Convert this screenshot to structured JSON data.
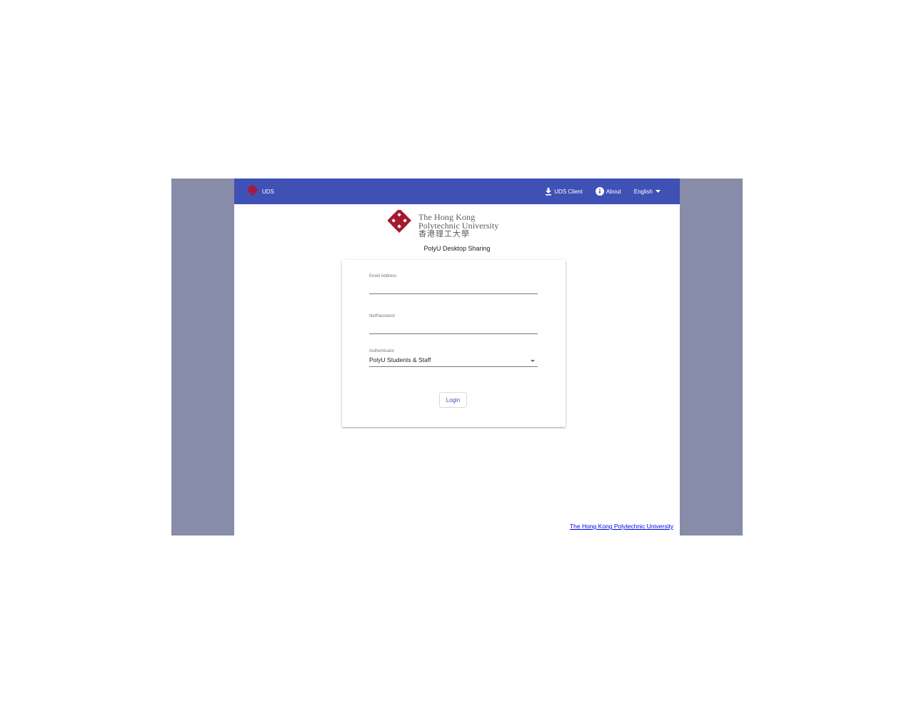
{
  "header": {
    "brand_label": "UDS",
    "client_label": "UDS Client",
    "about_label": "About",
    "language_label": "English",
    "bar_color": "#3f51b5",
    "icons": {
      "brand": "polyu-emblem-icon",
      "client": "download-icon",
      "about": "info-icon",
      "language": "chevron-down-icon"
    }
  },
  "logo": {
    "line1": "The Hong Kong",
    "line2": "Polytechnic University",
    "chinese": "香港理工大學",
    "brand_color": "#a6192e"
  },
  "page": {
    "title": "PolyU Desktop Sharing",
    "background_color": "#878da8"
  },
  "form": {
    "email": {
      "label": "Email Address",
      "value": ""
    },
    "password": {
      "label": "NetPassword",
      "value": ""
    },
    "authenticator": {
      "label": "Authenticator",
      "selected": "PolyU Students & Staff"
    },
    "login_label": "Login"
  },
  "footer": {
    "link_text": "The Hong Kong Polytechnic University"
  }
}
